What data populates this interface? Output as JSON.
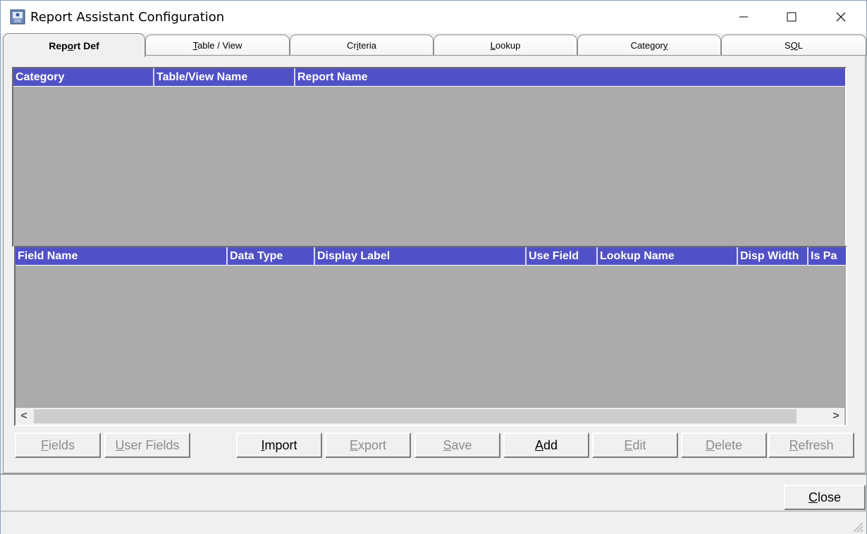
{
  "window": {
    "title": "Report Assistant Configuration",
    "icon": "report-app-icon",
    "controls": [
      "minimize-icon",
      "maximize-icon",
      "close-icon"
    ]
  },
  "tabs": [
    {
      "label_pre": "Rep",
      "label_u": "o",
      "label_post": "rt Def",
      "active": true
    },
    {
      "label_pre": "",
      "label_u": "T",
      "label_post": "able / View",
      "active": false
    },
    {
      "label_pre": "Cr",
      "label_u": "i",
      "label_post": "teria",
      "active": false
    },
    {
      "label_pre": "",
      "label_u": "L",
      "label_post": "ookup",
      "active": false
    },
    {
      "label_pre": "Categor",
      "label_u": "y",
      "label_post": "",
      "active": false
    },
    {
      "label_pre": "S",
      "label_u": "Q",
      "label_post": "L",
      "active": false
    }
  ],
  "report_grid": {
    "columns": [
      "Category",
      "Table/View Name",
      "Report Name"
    ],
    "rows": []
  },
  "field_grid": {
    "columns": [
      "Field Name",
      "Data Type",
      "Display Label",
      "Use Field",
      "Lookup Name",
      "Disp Width",
      "Is Pa"
    ],
    "rows": [],
    "scroll_left": "<",
    "scroll_right": ">"
  },
  "buttons": [
    {
      "pre": "",
      "u": "F",
      "post": "ields",
      "enabled": false
    },
    {
      "pre": "",
      "u": "U",
      "post": "ser Fields",
      "enabled": false
    },
    {
      "pre": "",
      "u": "I",
      "post": "mport",
      "enabled": true
    },
    {
      "pre": "",
      "u": "E",
      "post": "xport",
      "enabled": false
    },
    {
      "pre": "",
      "u": "S",
      "post": "ave",
      "enabled": false
    },
    {
      "pre": "",
      "u": "A",
      "post": "dd",
      "enabled": true
    },
    {
      "pre": "",
      "u": "E",
      "post": "dit",
      "enabled": false
    },
    {
      "pre": "",
      "u": "D",
      "post": "elete",
      "enabled": false
    },
    {
      "pre": "",
      "u": "R",
      "post": "efresh",
      "enabled": false
    }
  ],
  "close_button": {
    "pre": "",
    "u": "C",
    "post": "lose"
  },
  "colors": {
    "header_bg": "#5151c7",
    "grid_bg": "#ababab",
    "disabled_text": "#8c8c8c"
  }
}
